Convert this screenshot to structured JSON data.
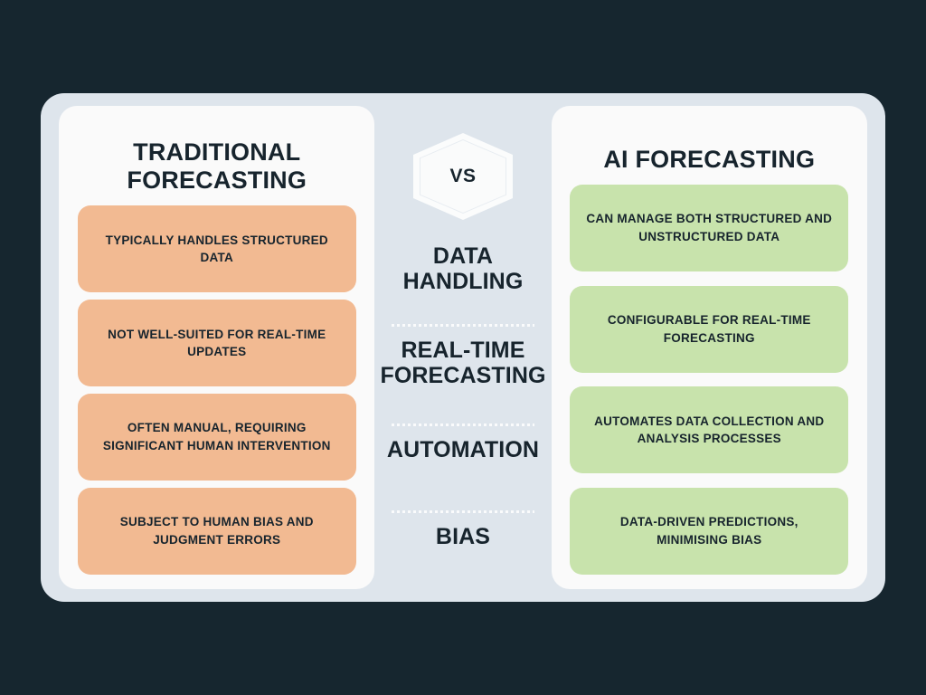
{
  "background_color": "#16262f",
  "panel_color": "#dee5ec",
  "card_color": "#fafafa",
  "left": {
    "title": "TRADITIONAL FORECASTING",
    "accent_color": "#f2ba92",
    "items": [
      "TYPICALLY HANDLES STRUCTURED DATA",
      "NOT WELL-SUITED FOR REAL-TIME UPDATES",
      "OFTEN MANUAL, REQUIRING SIGNIFICANT HUMAN INTERVENTION",
      "SUBJECT TO HUMAN BIAS AND JUDGMENT ERRORS"
    ]
  },
  "center": {
    "badge": "VS",
    "labels": [
      "DATA HANDLING",
      "REAL-TIME FORECASTING",
      "AUTOMATION",
      "BIAS"
    ]
  },
  "right": {
    "title": "AI FORECASTING",
    "accent_color": "#c8e3ac",
    "items": [
      "CAN MANAGE BOTH STRUCTURED AND UNSTRUCTURED DATA",
      "CONFIGURABLE FOR REAL-TIME FORECASTING",
      "AUTOMATES DATA COLLECTION AND ANALYSIS PROCESSES",
      "DATA-DRIVEN PREDICTIONS, MINIMISING BIAS"
    ]
  }
}
